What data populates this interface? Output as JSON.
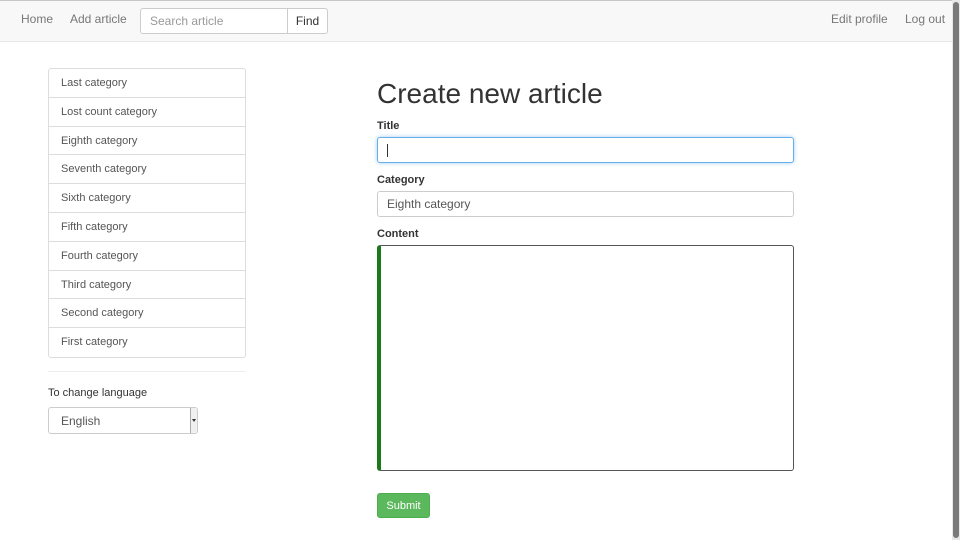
{
  "navbar": {
    "home_label": "Home",
    "add_article_label": "Add article",
    "search_placeholder": "Search article",
    "find_label": "Find",
    "edit_profile_label": "Edit profile",
    "logout_label": "Log out"
  },
  "sidebar": {
    "categories": [
      {
        "label": "Last category"
      },
      {
        "label": "Lost count category"
      },
      {
        "label": "Eighth category"
      },
      {
        "label": "Seventh category"
      },
      {
        "label": "Sixth category"
      },
      {
        "label": "Fifth category"
      },
      {
        "label": "Fourth category"
      },
      {
        "label": "Third category"
      },
      {
        "label": "Second category"
      },
      {
        "label": "First category"
      }
    ],
    "language_label": "To change language",
    "language_value": "English"
  },
  "form": {
    "page_title": "Create new article",
    "title_label": "Title",
    "title_value": "",
    "category_label": "Category",
    "category_value": "Eighth category",
    "content_label": "Content",
    "content_value": "",
    "submit_label": "Submit"
  },
  "colors": {
    "submit_button": "#5cb85c",
    "focus_border": "#66afe9",
    "content_left_border": "#1a7a1a",
    "navbar_background": "#f8f8f8"
  }
}
